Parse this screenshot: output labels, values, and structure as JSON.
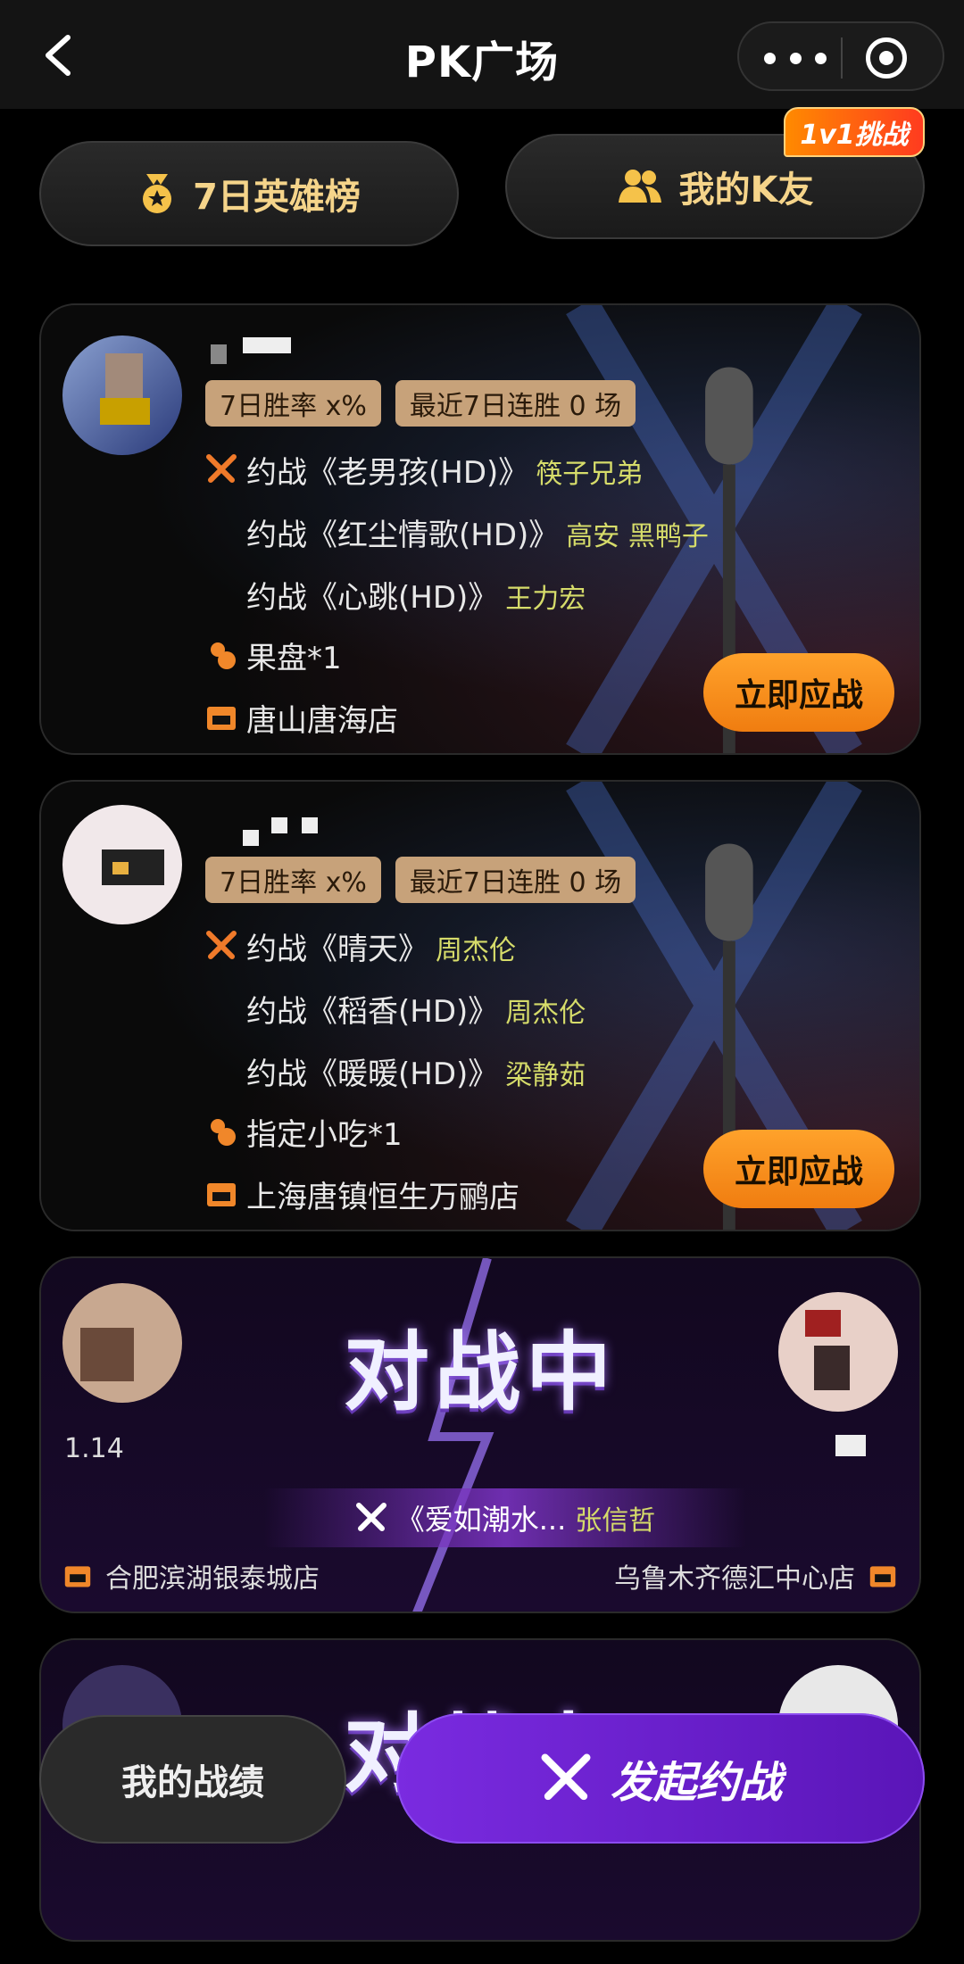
{
  "header": {
    "title": "PK广场"
  },
  "top_buttons": {
    "hero_board": "7日英雄榜",
    "my_friends": "我的K友",
    "challenge_badge": "1v1挑战"
  },
  "challenges": [
    {
      "win_rate": "7日胜率 x%",
      "streak": "最近7日连胜 0 场",
      "songs": [
        {
          "title": "约战《老男孩(HD)》",
          "singer": "筷子兄弟"
        },
        {
          "title": "约战《红尘情歌(HD)》",
          "singer": "高安 黑鸭子"
        },
        {
          "title": "约战《心跳(HD)》",
          "singer": "王力宏"
        }
      ],
      "reward": "果盘*1",
      "store": "唐山唐海店",
      "cta": "立即应战"
    },
    {
      "win_rate": "7日胜率 x%",
      "streak": "最近7日连胜 0 场",
      "songs": [
        {
          "title": "约战《晴天》",
          "singer": "周杰伦"
        },
        {
          "title": "约战《稻香(HD)》",
          "singer": "周杰伦"
        },
        {
          "title": "约战《暖暖(HD)》",
          "singer": "梁静茹"
        }
      ],
      "reward": "指定小吃*1",
      "store": "上海唐镇恒生万鹂店",
      "cta": "立即应战"
    }
  ],
  "battle": {
    "title": "对战中",
    "left_name": "1.14",
    "song": "《爱如潮水...",
    "singer": "张信哲",
    "left_store": "合肥滨湖银泰城店",
    "right_store": "乌鲁木齐德汇中心店"
  },
  "battle2": {
    "title": "对战中"
  },
  "bottom": {
    "my_record": "我的战绩",
    "launch": "发起约战"
  },
  "colors": {
    "accent_orange": "#f5911e",
    "tag_bg": "#c7a27a",
    "singer_yellow": "#d6dc6a",
    "launch_purple": "#6a20cc"
  }
}
